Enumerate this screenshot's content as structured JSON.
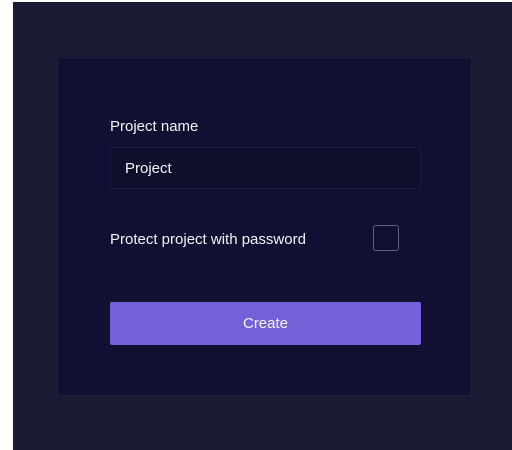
{
  "form": {
    "project_name_label": "Project name",
    "project_name_value": "Project",
    "protect_label": "Protect project with password",
    "protect_checked": false,
    "create_label": "Create"
  },
  "colors": {
    "window_background": "#1a1a34",
    "card_background": "#111032",
    "button_accent": "#7461d8",
    "text": "#f2f2f8"
  }
}
